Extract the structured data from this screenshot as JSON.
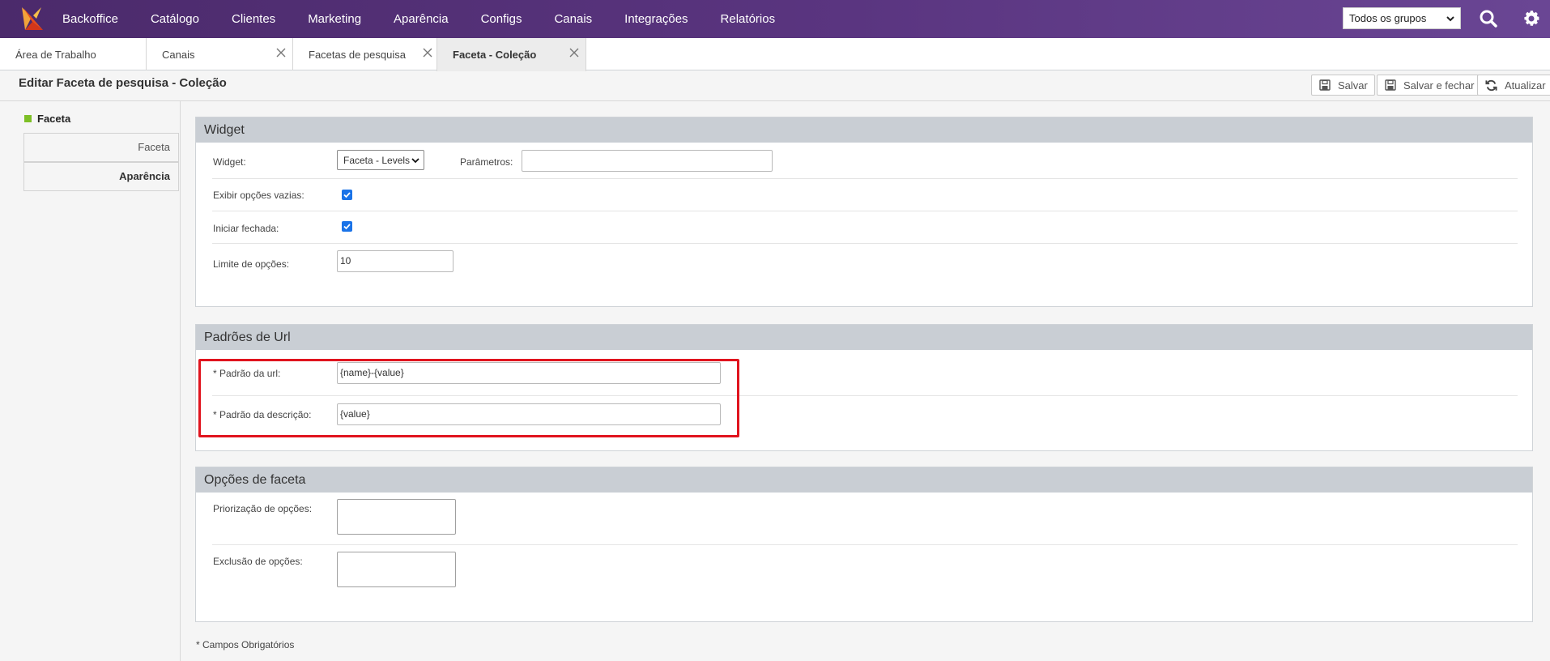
{
  "nav": {
    "items": [
      "Backoffice",
      "Catálogo",
      "Clientes",
      "Marketing",
      "Aparência",
      "Configs",
      "Canais",
      "Integrações",
      "Relatórios"
    ],
    "group_select": "Todos os grupos"
  },
  "tabs": [
    "Área de Trabalho",
    "Canais",
    "Facetas de pesquisa",
    "Faceta - Coleção"
  ],
  "page": {
    "title": "Editar Faceta de pesquisa - Coleção",
    "save": "Salvar",
    "save_close": "Salvar e fechar",
    "refresh": "Atualizar"
  },
  "sidebar": {
    "header": "Faceta",
    "items": [
      "Faceta",
      "Aparência"
    ]
  },
  "widget": {
    "title": "Widget",
    "widget_label": "Widget:",
    "widget_value": "Faceta - Levels",
    "params_label": "Parâmetros:",
    "params_value": "",
    "show_empty_label": "Exibir opções vazias:",
    "show_empty_checked": true,
    "start_closed_label": "Iniciar fechada:",
    "start_closed_checked": true,
    "limit_label": "Limite de opções:",
    "limit_value": "10"
  },
  "url_patterns": {
    "title": "Padrões de Url",
    "url_label": "* Padrão da url:",
    "url_value": "{name}-{value}",
    "desc_label": "* Padrão da descrição:",
    "desc_value": "{value}"
  },
  "facet_options": {
    "title": "Opções de faceta",
    "priority_label": "Priorização de opções:",
    "priority_value": "",
    "exclusion_label": "Exclusão de opções:",
    "exclusion_value": ""
  },
  "footnote": "* Campos Obrigatórios",
  "colors": {
    "nav_bg": "#5a3580",
    "accent_green": "#7dbf26",
    "highlight": "#e0141e",
    "checkbox": "#1a73e8",
    "panel_head": "#c9ced4"
  }
}
